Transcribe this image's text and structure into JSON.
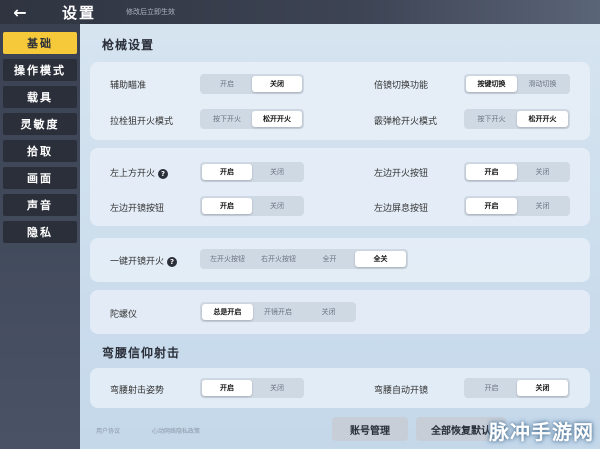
{
  "header": {
    "back_icon": "arrow-left-icon",
    "title": "设置",
    "hint": "修改后立即生效"
  },
  "sidebar": {
    "items": [
      {
        "label": "基础",
        "active": true
      },
      {
        "label": "操作模式",
        "active": false
      },
      {
        "label": "载具",
        "active": false
      },
      {
        "label": "灵敏度",
        "active": false
      },
      {
        "label": "拾取",
        "active": false
      },
      {
        "label": "画面",
        "active": false
      },
      {
        "label": "声音",
        "active": false
      },
      {
        "label": "隐私",
        "active": false
      }
    ]
  },
  "gun_section": {
    "title": "枪械设置",
    "aim_assist": {
      "label": "辅助瞄准",
      "options": [
        "开启",
        "关闭"
      ],
      "selected": 1
    },
    "scope_switch": {
      "label": "倍镜切换功能",
      "options": [
        "按键切换",
        "滑动切换"
      ],
      "selected": 0
    },
    "bolt_fire": {
      "label": "拉栓狙开火模式",
      "options": [
        "按下开火",
        "松开开火"
      ],
      "selected": 1
    },
    "shotgun_fire": {
      "label": "霰弹枪开火模式",
      "options": [
        "按下开火",
        "松开开火"
      ],
      "selected": 1
    },
    "top_left_fire": {
      "label": "左上方开火",
      "options": [
        "开启",
        "关闭"
      ],
      "selected": 0
    },
    "left_fire_btn": {
      "label": "左边开火按钮",
      "options": [
        "开启",
        "关闭"
      ],
      "selected": 0
    },
    "left_scope_btn": {
      "label": "左边开镜按钮",
      "options": [
        "开启",
        "关闭"
      ],
      "selected": 0
    },
    "left_hold_breath": {
      "label": "左边屏息按钮",
      "options": [
        "开启",
        "关闭"
      ],
      "selected": 0
    },
    "one_key_scope": {
      "label": "一键开镜开火",
      "options": [
        "左开火按钮",
        "右开火按钮",
        "全开",
        "全关"
      ],
      "selected": 3
    },
    "gyro": {
      "label": "陀螺仪",
      "options": [
        "总是开启",
        "开镜开启",
        "关闭"
      ],
      "selected": 0
    }
  },
  "crouch_section": {
    "title": "弯腰信仰射击",
    "crouch_pose": {
      "label": "弯腰射击姿势",
      "options": [
        "开启",
        "关闭"
      ],
      "selected": 0
    },
    "crouch_auto_scope": {
      "label": "弯腰自动开镜",
      "options": [
        "开启",
        "关闭"
      ],
      "selected": 1
    }
  },
  "footer": {
    "user_agreement": "用户协议",
    "child_privacy": "心动网络隐私政策",
    "account_btn": "账号管理",
    "reset_btn": "全部恢复默认",
    "watermark": "脉冲手游网"
  },
  "colors": {
    "accent": "#f5c93a",
    "sidebar_bg": "#2a2f3a",
    "panel_bg": "#c9dcec"
  }
}
